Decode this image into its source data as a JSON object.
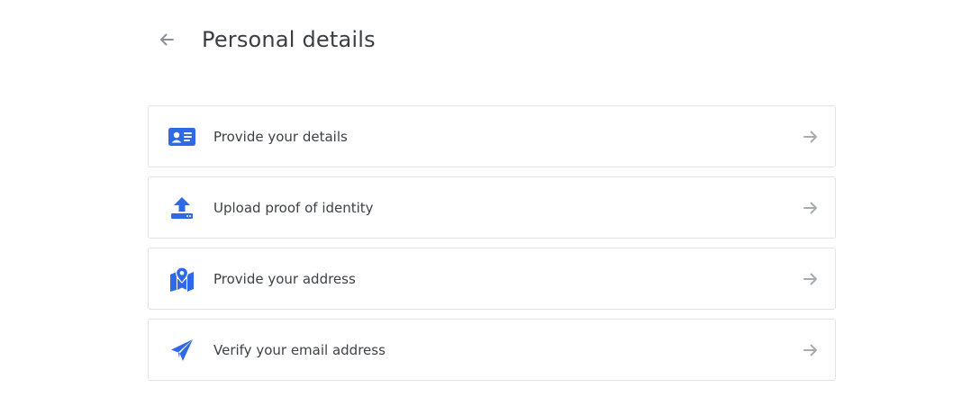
{
  "header": {
    "title": "Personal details",
    "back_icon": "arrow-left-icon"
  },
  "colors": {
    "accent": "#2f6ae6",
    "arrow": "#a7abb0",
    "border": "#e1e3e6",
    "title": "#3a3e44"
  },
  "items": [
    {
      "label": "Provide your details",
      "icon": "id-card-icon",
      "trailing_icon": "arrow-right-icon"
    },
    {
      "label": "Upload proof of identity",
      "icon": "upload-icon",
      "trailing_icon": "arrow-right-icon"
    },
    {
      "label": "Provide your address",
      "icon": "map-pin-icon",
      "trailing_icon": "arrow-right-icon"
    },
    {
      "label": "Verify your email address",
      "icon": "paper-plane-icon",
      "trailing_icon": "arrow-right-icon"
    }
  ]
}
